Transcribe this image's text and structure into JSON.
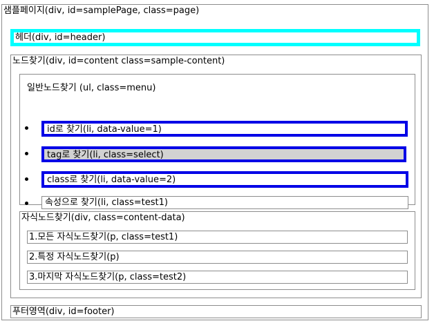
{
  "page": {
    "label": "샘플페이지(div, id=samplePage, class=page)"
  },
  "header": {
    "label": "헤더(div, id=header)"
  },
  "content": {
    "label": "노드찾기(div, id=content class=sample-content)",
    "menu": {
      "label": "일반노드찾기 (ul, class=menu)",
      "items": [
        {
          "label": "id로 찾기(li, data-value=1)",
          "style": "blue-border"
        },
        {
          "label": "tag로 찾기(li, class=select)",
          "style": "blue-border-gray-fill"
        },
        {
          "label": "class로 찾기(li, data-value=2)",
          "style": "blue-border"
        },
        {
          "label": "속성으로 찾기(li, class=test1)",
          "style": "plain"
        }
      ]
    },
    "content_data": {
      "label": "자식노드찾기(div, class=content-data)",
      "items": [
        {
          "label": "1.모든 자식노드찾기(p, class=test1)"
        },
        {
          "label": "2.특정 자식노드찾기(p)"
        },
        {
          "label": "3.마지막 자식노드찾기(p, class=test2)"
        }
      ]
    }
  },
  "footer": {
    "label": "푸터영역(div, id=footer)"
  },
  "colors": {
    "header_border": "#00ffff",
    "highlight_border": "#0000e6",
    "select_fill": "#d2d2d2",
    "box_border": "#8c8c8c"
  }
}
